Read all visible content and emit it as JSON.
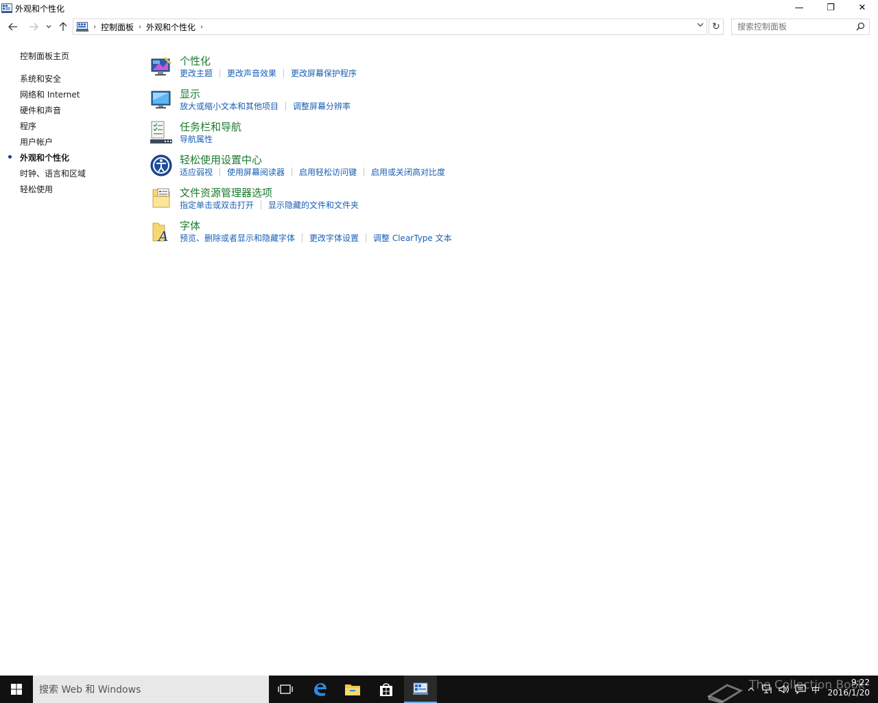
{
  "window": {
    "title": "外观和个性化",
    "controls": {
      "minimize": "—",
      "restore": "❐",
      "close": "✕"
    }
  },
  "navigation": {
    "back_icon": "arrow-left-icon",
    "forward_icon": "arrow-right-icon",
    "recent_icon": "chevron-down-icon",
    "up_icon": "arrow-up-icon",
    "breadcrumbs": [
      "控制面板",
      "外观和个性化"
    ],
    "search_placeholder": "搜索控制面板"
  },
  "sidebar": {
    "home": "控制面板主页",
    "items": [
      {
        "label": "系统和安全",
        "active": false
      },
      {
        "label": "网络和 Internet",
        "active": false
      },
      {
        "label": "硬件和声音",
        "active": false
      },
      {
        "label": "程序",
        "active": false
      },
      {
        "label": "用户帐户",
        "active": false
      },
      {
        "label": "外观和个性化",
        "active": true
      },
      {
        "label": "时钟、语言和区域",
        "active": false
      },
      {
        "label": "轻松使用",
        "active": false
      }
    ]
  },
  "categories": [
    {
      "title": "个性化",
      "icon": "personalization-icon",
      "links": [
        "更改主题",
        "更改声音效果",
        "更改屏幕保护程序"
      ]
    },
    {
      "title": "显示",
      "icon": "display-icon",
      "links": [
        "放大或缩小文本和其他项目",
        "调整屏幕分辨率"
      ]
    },
    {
      "title": "任务栏和导航",
      "icon": "taskbar-icon",
      "links": [
        "导航属性"
      ]
    },
    {
      "title": "轻松使用设置中心",
      "icon": "ease-of-access-icon",
      "links": [
        "适应弱视",
        "使用屏幕阅读器",
        "启用轻松访问键",
        "启用或关闭高对比度"
      ]
    },
    {
      "title": "文件资源管理器选项",
      "icon": "folder-options-icon",
      "links": [
        "指定单击或双击打开",
        "显示隐藏的文件和文件夹"
      ]
    },
    {
      "title": "字体",
      "icon": "fonts-icon",
      "links": [
        "预览、删除或者显示和隐藏字体",
        "更改字体设置",
        "调整 ClearType 文本"
      ]
    }
  ],
  "taskbar": {
    "search_placeholder": "搜索 Web 和 Windows",
    "ime": "中",
    "time": "9:22",
    "date": "2016/1/20",
    "watermark": "The Collection Book"
  },
  "colors": {
    "category_title": "#1a7a2e",
    "link": "#1a5fb4",
    "taskbar": "#111111"
  }
}
